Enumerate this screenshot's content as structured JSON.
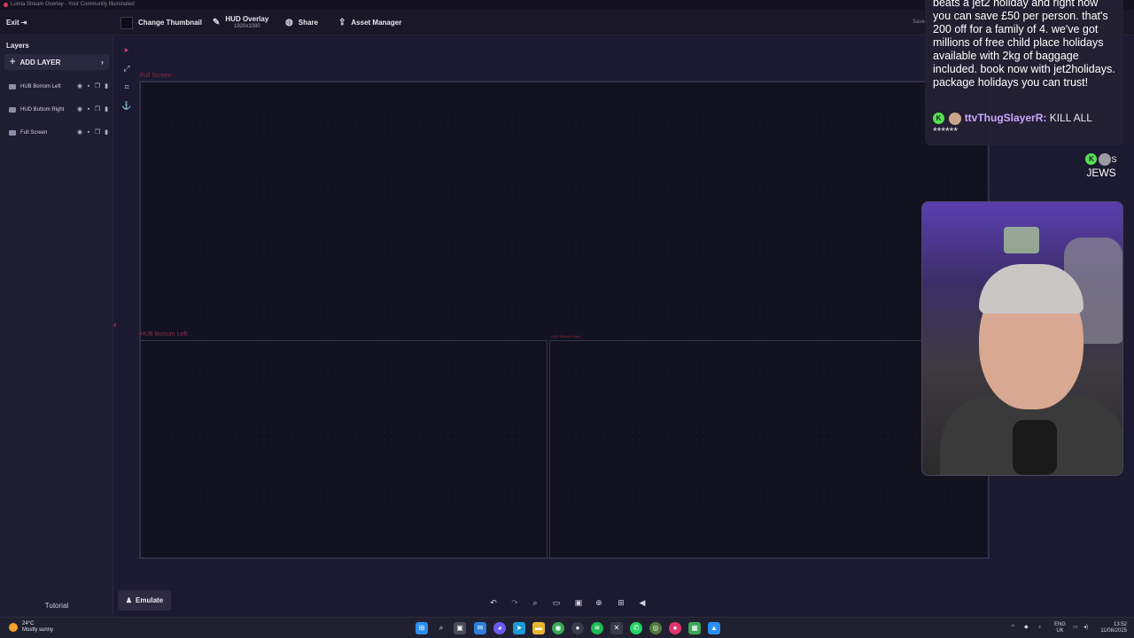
{
  "window": {
    "title": "Lumia Stream Overlay - Your Community Illuminated"
  },
  "toolbar": {
    "exit_label": "Exit",
    "change_thumbnail_label": "Change Thumbnail",
    "overlay_name": "HUD Overlay",
    "overlay_resolution": "1920x1080",
    "share_label": "Share",
    "asset_manager_label": "Asset Manager",
    "save_status": "Saved"
  },
  "layers_panel": {
    "title": "Layers",
    "add_layer_label": "ADD LAYER",
    "items": [
      {
        "label": "HUB Borrom Left"
      },
      {
        "label": "HUD Buttom Right"
      },
      {
        "label": "Full Screen"
      }
    ],
    "tutorial_label": "Tutorial"
  },
  "canvas": {
    "full_screen_label": "Full Screen",
    "bottom_left_label": "HUB Borrom Left",
    "bottom_right_label": "HUD Buttom Right"
  },
  "emulate_label": "Emulate",
  "chat": {
    "message": "beats a jet2 holiday and right now you can save £50 per person. that's 200 off for a family of 4. we've got millions of free child place holidays available with 2kg of baggage included. book now with jet2holidays. package holidays you can trust!",
    "user2_name": "ttvThugSlayerR:",
    "user2_text": " KILL ALL ******",
    "user3_initial": "S",
    "user3_text": "JEWS"
  },
  "taskbar": {
    "temperature": "24°C",
    "weather_desc": "Mostly sunny",
    "lang_top": "ENG",
    "lang_bottom": "UK",
    "time": "13:52",
    "date": "11/08/2025"
  },
  "colors": {
    "accent": "#e0356c",
    "background": "#1c1a30",
    "canvas": "#131220",
    "chat_username": "#c9a7ff",
    "badge": "#52e34d"
  }
}
